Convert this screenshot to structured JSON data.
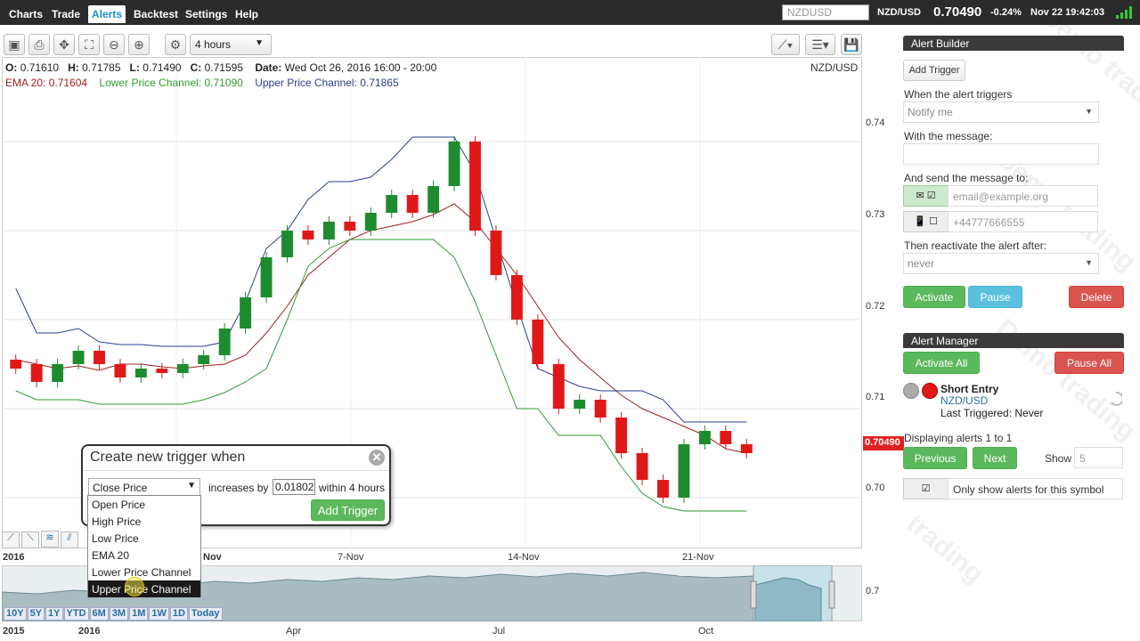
{
  "nav": {
    "items": [
      "Charts",
      "Trade",
      "Alerts",
      "Backtest",
      "Settings",
      "Help"
    ],
    "active": "Alerts",
    "search_placeholder": "NZDUSD",
    "symbol": "NZD/USD",
    "price": "0.70490",
    "change": "-0.24%",
    "datetime": "Nov 22 19:42:03"
  },
  "toolbar": {
    "interval": "4 hours"
  },
  "chart_header": {
    "o_label": "O:",
    "o": "0.71610",
    "h_label": "H:",
    "h": "0.71785",
    "l_label": "L:",
    "l": "0.71490",
    "c_label": "C:",
    "c": "0.71595",
    "date_label": "Date:",
    "date": "Wed Oct 26, 2016 16:00 - 20:00",
    "ema": "EMA 20: 0.71604",
    "lower": "Lower Price Channel: 0.71090",
    "upper": "Upper Price Channel: 0.71865",
    "symbol": "NZD/USD"
  },
  "colors": {
    "up": "#1e8c2e",
    "down": "#e01818",
    "ema": "#a02020",
    "lower": "#2f9a2f",
    "upper": "#2a3f8f",
    "accent": "#1a8fd6"
  },
  "chart_data": {
    "type": "candlestick",
    "y_ticks": [
      "0.74",
      "0.73",
      "0.72",
      "0.71",
      "0.70"
    ],
    "x_ticks": [
      "2016",
      "Nov",
      "7-Nov",
      "14-Nov",
      "21-Nov"
    ],
    "last_price": "0.70490",
    "ylim": [
      0.6945,
      0.7455
    ],
    "series": [
      {
        "name": "EMA 20",
        "values": [
          0.7155,
          0.715,
          0.7145,
          0.7148,
          0.7143,
          0.715,
          0.715,
          0.7147,
          0.7145,
          0.7148,
          0.715,
          0.716,
          0.7185,
          0.7215,
          0.725,
          0.727,
          0.729,
          0.73,
          0.7305,
          0.731,
          0.7318,
          0.733,
          0.731,
          0.728,
          0.725,
          0.7215,
          0.718,
          0.7155,
          0.7135,
          0.7115,
          0.71,
          0.709,
          0.708,
          0.707,
          0.7055,
          0.705
        ]
      },
      {
        "name": "Lower Price Channel",
        "values": [
          0.712,
          0.711,
          0.711,
          0.711,
          0.7105,
          0.7105,
          0.7105,
          0.7105,
          0.7105,
          0.711,
          0.7118,
          0.713,
          0.7145,
          0.72,
          0.726,
          0.728,
          0.729,
          0.729,
          0.729,
          0.729,
          0.729,
          0.727,
          0.722,
          0.716,
          0.71,
          0.71,
          0.707,
          0.707,
          0.707,
          0.7035,
          0.7005,
          0.699,
          0.6985,
          0.6985,
          0.6985,
          0.6985
        ]
      },
      {
        "name": "Upper Price Channel",
        "values": [
          0.7235,
          0.7185,
          0.7185,
          0.719,
          0.7175,
          0.7172,
          0.7172,
          0.717,
          0.717,
          0.717,
          0.7175,
          0.722,
          0.728,
          0.73,
          0.7335,
          0.7355,
          0.7355,
          0.736,
          0.738,
          0.7405,
          0.7405,
          0.7405,
          0.7365,
          0.729,
          0.7215,
          0.7145,
          0.7135,
          0.7125,
          0.712,
          0.712,
          0.712,
          0.711,
          0.7085,
          0.7085,
          0.7085,
          0.7085
        ]
      }
    ],
    "candles": [
      [
        0.7155,
        0.7145
      ],
      [
        0.715,
        0.713
      ],
      [
        0.713,
        0.715
      ],
      [
        0.715,
        0.7165
      ],
      [
        0.7165,
        0.715
      ],
      [
        0.715,
        0.7135
      ],
      [
        0.7135,
        0.7145
      ],
      [
        0.7145,
        0.714
      ],
      [
        0.714,
        0.715
      ],
      [
        0.715,
        0.716
      ],
      [
        0.716,
        0.719
      ],
      [
        0.719,
        0.7225
      ],
      [
        0.7225,
        0.727
      ],
      [
        0.727,
        0.73
      ],
      [
        0.73,
        0.729
      ],
      [
        0.729,
        0.731
      ],
      [
        0.731,
        0.73
      ],
      [
        0.73,
        0.732
      ],
      [
        0.732,
        0.734
      ],
      [
        0.734,
        0.732
      ],
      [
        0.732,
        0.735
      ],
      [
        0.735,
        0.74
      ],
      [
        0.74,
        0.73
      ],
      [
        0.73,
        0.725
      ],
      [
        0.725,
        0.72
      ],
      [
        0.72,
        0.715
      ],
      [
        0.715,
        0.71
      ],
      [
        0.71,
        0.711
      ],
      [
        0.711,
        0.709
      ],
      [
        0.709,
        0.705
      ],
      [
        0.705,
        0.702
      ],
      [
        0.702,
        0.7
      ],
      [
        0.7,
        0.706
      ],
      [
        0.706,
        0.7075
      ],
      [
        0.7075,
        0.706
      ],
      [
        0.706,
        0.705
      ]
    ]
  },
  "navigator": {
    "y_tick": "0.7",
    "zoom": [
      "10Y",
      "5Y",
      "1Y",
      "YTD",
      "6M",
      "3M",
      "1M",
      "1W",
      "1D",
      "Today"
    ],
    "ticks": [
      "2015",
      "2016",
      "Apr",
      "Jul",
      "Oct"
    ]
  },
  "dialog": {
    "title": "Create new trigger when",
    "selected": "Close Price",
    "increases_by": "increases by",
    "value": "0.01802",
    "within": "within 4 hours",
    "add_label": "Add Trigger",
    "options": [
      "Open Price",
      "High Price",
      "Low Price",
      "EMA 20",
      "Lower Price Channel",
      "Upper Price Channel"
    ],
    "highlighted": "Upper Price Channel"
  },
  "alert_builder": {
    "title": "Alert Builder",
    "add_trigger": "Add Trigger",
    "when_label": "When the alert triggers",
    "when_value": "Notify me",
    "message_label": "With the message:",
    "send_label": "And send the message to:",
    "email_placeholder": "email@example.org",
    "phone_placeholder": "+44777666555",
    "reactivate_label": "Then reactivate the alert after:",
    "reactivate_value": "never",
    "activate": "Activate",
    "pause": "Pause",
    "delete": "Delete"
  },
  "alert_manager": {
    "title": "Alert Manager",
    "activate_all": "Activate All",
    "pause_all": "Pause All",
    "alert_name": "Short Entry",
    "alert_symbol": "NZD/USD",
    "alert_last": "Last Triggered: Never",
    "displaying": "Displaying alerts 1 to 1",
    "previous": "Previous",
    "next": "Next",
    "show_label": "Show",
    "show_value": "5",
    "only_symbol": "Only show alerts for this symbol"
  }
}
